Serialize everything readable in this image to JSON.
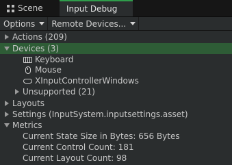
{
  "tabs": [
    {
      "label": "Scene",
      "icon": "scene-grid-icon",
      "active": false
    },
    {
      "label": "Input Debug",
      "active": true
    }
  ],
  "toolbar": {
    "options_label": "Options",
    "remote_label": "Remote Devices..."
  },
  "tree": {
    "actions": "Actions (209)",
    "devices": "Devices (3)",
    "keyboard": "Keyboard",
    "mouse": "Mouse",
    "xinput": "XInputControllerWindows",
    "unsupported": "Unsupported (21)",
    "layouts": "Layouts",
    "settings": "Settings (InputSystem.inputsettings.asset)",
    "metrics": "Metrics",
    "state_size": "Current State Size in Bytes: 656 Bytes",
    "control_count": "Current Control Count: 181",
    "layout_count": "Current Layout Count: 98"
  },
  "colors": {
    "accent": "#2f9d4b",
    "selected_row": "#2e5c36",
    "panel_bg": "#2a2d2e"
  }
}
